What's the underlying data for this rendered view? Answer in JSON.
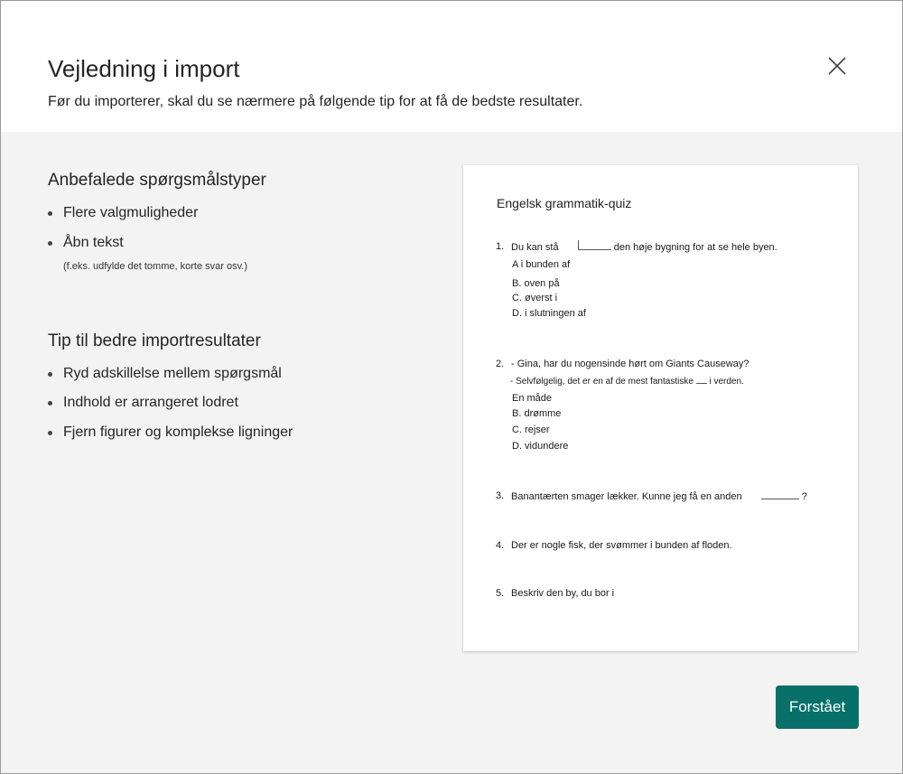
{
  "dialog": {
    "title": "Vejledning i import",
    "subtitle": "Før du importerer, skal du se nærmere på følgende tip for at få de bedste resultater.",
    "close_icon": "close-icon"
  },
  "recommended": {
    "heading": "Anbefalede spørgsmålstyper",
    "items": [
      "Flere valgmuligheder",
      "Åbn tekst"
    ],
    "note": "(f.eks. udfylde det tomme, korte svar osv.)"
  },
  "tips": {
    "heading": "Tip til bedre importresultater",
    "items": [
      "Ryd adskillelse mellem spørgsmål",
      "Indhold er arrangeret lodret",
      "Fjern figurer og komplekse ligninger"
    ]
  },
  "preview": {
    "title": "Engelsk grammatik-quiz",
    "questions": [
      {
        "number": "1.",
        "text_before": "Du kan stå",
        "text_after": "den høje bygning for at se hele byen.",
        "options": [
          "A i bunden af",
          "B. oven på",
          "C. øverst i",
          "D. i slutningen af"
        ]
      },
      {
        "number": "2.",
        "line1": "- Gina, har du nogensinde hørt om Giants Causeway?",
        "line2_before": "- Selvfølgelig, det er en af de mest fantastiske",
        "line2_after": "i verden.",
        "options": [
          "En måde",
          "B. drømme",
          "C. rejser",
          "D. vidundere"
        ]
      },
      {
        "number": "3.",
        "text": "Banantærten smager lækker. Kunne jeg få en anden",
        "text_end": "?"
      },
      {
        "number": "4.",
        "text": "Der er nogle fisk, der svømmer i bunden af floden."
      },
      {
        "number": "5.",
        "text": "Beskriv den by, du bor i"
      }
    ]
  },
  "actions": {
    "primary_label": "Forstået",
    "primary_color": "#077169"
  }
}
